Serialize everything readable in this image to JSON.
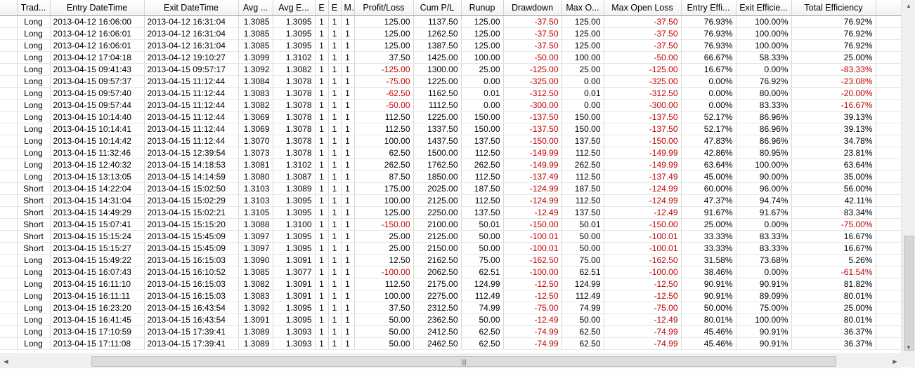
{
  "columns": [
    "",
    "Trad...",
    "Entry DateTime",
    "Exit DateTime",
    "Avg ...",
    "Avg E...",
    "E",
    "E",
    "M",
    "Profit/Loss",
    "Cum P/L",
    "Runup",
    "Drawdown",
    "Max O...",
    "Max Open Loss",
    "Entry Effi...",
    "Exit Efficie...",
    "Total Efficiency",
    ""
  ],
  "rows": [
    [
      "Long",
      "2013-04-12 16:06:00",
      "2013-04-12 16:31:04",
      "1.3085",
      "1.3095",
      "1",
      "1",
      "1",
      "125.00",
      "1137.50",
      "125.00",
      "-37.50",
      "125.00",
      "-37.50",
      "76.93%",
      "100.00%",
      "76.92%"
    ],
    [
      "Long",
      "2013-04-12 16:06:01",
      "2013-04-12 16:31:04",
      "1.3085",
      "1.3095",
      "1",
      "1",
      "1",
      "125.00",
      "1262.50",
      "125.00",
      "-37.50",
      "125.00",
      "-37.50",
      "76.93%",
      "100.00%",
      "76.92%"
    ],
    [
      "Long",
      "2013-04-12 16:06:01",
      "2013-04-12 16:31:04",
      "1.3085",
      "1.3095",
      "1",
      "1",
      "1",
      "125.00",
      "1387.50",
      "125.00",
      "-37.50",
      "125.00",
      "-37.50",
      "76.93%",
      "100.00%",
      "76.92%"
    ],
    [
      "Long",
      "2013-04-12 17:04:18",
      "2013-04-12 19:10:27",
      "1.3099",
      "1.3102",
      "1",
      "1",
      "1",
      "37.50",
      "1425.00",
      "100.00",
      "-50.00",
      "100.00",
      "-50.00",
      "66.67%",
      "58.33%",
      "25.00%"
    ],
    [
      "Long",
      "2013-04-15 09:41:43",
      "2013-04-15 09:57:17",
      "1.3092",
      "1.3082",
      "1",
      "1",
      "1",
      "-125.00",
      "1300.00",
      "25.00",
      "-125.00",
      "25.00",
      "-125.00",
      "16.67%",
      "0.00%",
      "-83.33%"
    ],
    [
      "Long",
      "2013-04-15 09:57:37",
      "2013-04-15 11:12:44",
      "1.3084",
      "1.3078",
      "1",
      "1",
      "1",
      "-75.00",
      "1225.00",
      "0.00",
      "-325.00",
      "0.00",
      "-325.00",
      "0.00%",
      "76.92%",
      "-23.08%"
    ],
    [
      "Long",
      "2013-04-15 09:57:40",
      "2013-04-15 11:12:44",
      "1.3083",
      "1.3078",
      "1",
      "1",
      "1",
      "-62.50",
      "1162.50",
      "0.01",
      "-312.50",
      "0.01",
      "-312.50",
      "0.00%",
      "80.00%",
      "-20.00%"
    ],
    [
      "Long",
      "2013-04-15 09:57:44",
      "2013-04-15 11:12:44",
      "1.3082",
      "1.3078",
      "1",
      "1",
      "1",
      "-50.00",
      "1112.50",
      "0.00",
      "-300.00",
      "0.00",
      "-300.00",
      "0.00%",
      "83.33%",
      "-16.67%"
    ],
    [
      "Long",
      "2013-04-15 10:14:40",
      "2013-04-15 11:12:44",
      "1.3069",
      "1.3078",
      "1",
      "1",
      "1",
      "112.50",
      "1225.00",
      "150.00",
      "-137.50",
      "150.00",
      "-137.50",
      "52.17%",
      "86.96%",
      "39.13%"
    ],
    [
      "Long",
      "2013-04-15 10:14:41",
      "2013-04-15 11:12:44",
      "1.3069",
      "1.3078",
      "1",
      "1",
      "1",
      "112.50",
      "1337.50",
      "150.00",
      "-137.50",
      "150.00",
      "-137.50",
      "52.17%",
      "86.96%",
      "39.13%"
    ],
    [
      "Long",
      "2013-04-15 10:14:42",
      "2013-04-15 11:12:44",
      "1.3070",
      "1.3078",
      "1",
      "1",
      "1",
      "100.00",
      "1437.50",
      "137.50",
      "-150.00",
      "137.50",
      "-150.00",
      "47.83%",
      "86.96%",
      "34.78%"
    ],
    [
      "Long",
      "2013-04-15 11:32:46",
      "2013-04-15 12:39:54",
      "1.3073",
      "1.3078",
      "1",
      "1",
      "1",
      "62.50",
      "1500.00",
      "112.50",
      "-149.99",
      "112.50",
      "-149.99",
      "42.86%",
      "80.95%",
      "23.81%"
    ],
    [
      "Long",
      "2013-04-15 12:40:32",
      "2013-04-15 14:18:53",
      "1.3081",
      "1.3102",
      "1",
      "1",
      "1",
      "262.50",
      "1762.50",
      "262.50",
      "-149.99",
      "262.50",
      "-149.99",
      "63.64%",
      "100.00%",
      "63.64%"
    ],
    [
      "Long",
      "2013-04-15 13:13:05",
      "2013-04-15 14:14:59",
      "1.3080",
      "1.3087",
      "1",
      "1",
      "1",
      "87.50",
      "1850.00",
      "112.50",
      "-137.49",
      "112.50",
      "-137.49",
      "45.00%",
      "90.00%",
      "35.00%"
    ],
    [
      "Short",
      "2013-04-15 14:22:04",
      "2013-04-15 15:02:50",
      "1.3103",
      "1.3089",
      "1",
      "1",
      "1",
      "175.00",
      "2025.00",
      "187.50",
      "-124.99",
      "187.50",
      "-124.99",
      "60.00%",
      "96.00%",
      "56.00%"
    ],
    [
      "Short",
      "2013-04-15 14:31:04",
      "2013-04-15 15:02:29",
      "1.3103",
      "1.3095",
      "1",
      "1",
      "1",
      "100.00",
      "2125.00",
      "112.50",
      "-124.99",
      "112.50",
      "-124.99",
      "47.37%",
      "94.74%",
      "42.11%"
    ],
    [
      "Short",
      "2013-04-15 14:49:29",
      "2013-04-15 15:02:21",
      "1.3105",
      "1.3095",
      "1",
      "1",
      "1",
      "125.00",
      "2250.00",
      "137.50",
      "-12.49",
      "137.50",
      "-12.49",
      "91.67%",
      "91.67%",
      "83.34%"
    ],
    [
      "Short",
      "2013-04-15 15:07:41",
      "2013-04-15 15:15:20",
      "1.3088",
      "1.3100",
      "1",
      "1",
      "1",
      "-150.00",
      "2100.00",
      "50.01",
      "-150.00",
      "50.01",
      "-150.00",
      "25.00%",
      "0.00%",
      "-75.00%"
    ],
    [
      "Short",
      "2013-04-15 15:15:24",
      "2013-04-15 15:45:09",
      "1.3097",
      "1.3095",
      "1",
      "1",
      "1",
      "25.00",
      "2125.00",
      "50.00",
      "-100.01",
      "50.00",
      "-100.01",
      "33.33%",
      "83.33%",
      "16.67%"
    ],
    [
      "Short",
      "2013-04-15 15:15:27",
      "2013-04-15 15:45:09",
      "1.3097",
      "1.3095",
      "1",
      "1",
      "1",
      "25.00",
      "2150.00",
      "50.00",
      "-100.01",
      "50.00",
      "-100.01",
      "33.33%",
      "83.33%",
      "16.67%"
    ],
    [
      "Long",
      "2013-04-15 15:49:22",
      "2013-04-15 16:15:03",
      "1.3090",
      "1.3091",
      "1",
      "1",
      "1",
      "12.50",
      "2162.50",
      "75.00",
      "-162.50",
      "75.00",
      "-162.50",
      "31.58%",
      "73.68%",
      "5.26%"
    ],
    [
      "Long",
      "2013-04-15 16:07:43",
      "2013-04-15 16:10:52",
      "1.3085",
      "1.3077",
      "1",
      "1",
      "1",
      "-100.00",
      "2062.50",
      "62.51",
      "-100.00",
      "62.51",
      "-100.00",
      "38.46%",
      "0.00%",
      "-61.54%"
    ],
    [
      "Long",
      "2013-04-15 16:11:10",
      "2013-04-15 16:15:03",
      "1.3082",
      "1.3091",
      "1",
      "1",
      "1",
      "112.50",
      "2175.00",
      "124.99",
      "-12.50",
      "124.99",
      "-12.50",
      "90.91%",
      "90.91%",
      "81.82%"
    ],
    [
      "Long",
      "2013-04-15 16:11:11",
      "2013-04-15 16:15:03",
      "1.3083",
      "1.3091",
      "1",
      "1",
      "1",
      "100.00",
      "2275.00",
      "112.49",
      "-12.50",
      "112.49",
      "-12.50",
      "90.91%",
      "89.09%",
      "80.01%"
    ],
    [
      "Long",
      "2013-04-15 16:23:20",
      "2013-04-15 16:43:54",
      "1.3092",
      "1.3095",
      "1",
      "1",
      "1",
      "37.50",
      "2312.50",
      "74.99",
      "-75.00",
      "74.99",
      "-75.00",
      "50.00%",
      "75.00%",
      "25.00%"
    ],
    [
      "Long",
      "2013-04-15 16:41:45",
      "2013-04-15 16:43:54",
      "1.3091",
      "1.3095",
      "1",
      "1",
      "1",
      "50.00",
      "2362.50",
      "50.00",
      "-12.49",
      "50.00",
      "-12.49",
      "80.01%",
      "100.00%",
      "80.01%"
    ],
    [
      "Long",
      "2013-04-15 17:10:59",
      "2013-04-15 17:39:41",
      "1.3089",
      "1.3093",
      "1",
      "1",
      "1",
      "50.00",
      "2412.50",
      "62.50",
      "-74.99",
      "62.50",
      "-74.99",
      "45.46%",
      "90.91%",
      "36.37%"
    ],
    [
      "Long",
      "2013-04-15 17:11:08",
      "2013-04-15 17:39:41",
      "1.3089",
      "1.3093",
      "1",
      "1",
      "1",
      "50.00",
      "2462.50",
      "62.50",
      "-74.99",
      "62.50",
      "-74.99",
      "45.46%",
      "90.91%",
      "36.37%"
    ]
  ],
  "colors": {
    "negative": "#c00000"
  },
  "icons": {
    "scroll_up": "arrow-up-icon",
    "scroll_down": "arrow-down-icon",
    "scroll_left": "arrow-left-icon",
    "scroll_right": "arrow-right-icon",
    "thumb_grip": "grip-icon"
  }
}
